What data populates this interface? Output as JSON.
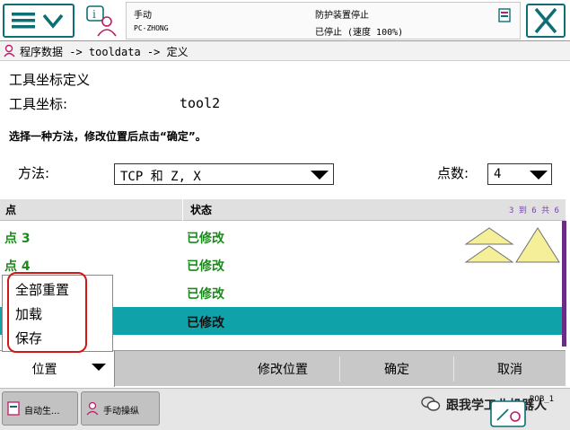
{
  "topbar": {
    "menu_icon": "hamburger-chevron-icon",
    "info_icon": "info-person-icon",
    "mode": "手动",
    "controller": "PC-ZHONG",
    "safety_status": "防护装置停止",
    "run_status": "已停止 (速度 100%)",
    "close_icon": "close-x-icon"
  },
  "breadcrumb": {
    "icon": "program-data-icon",
    "text": "程序数据 -> tooldata -> 定义"
  },
  "page": {
    "title": "工具坐标定义",
    "tool_label": "工具坐标:",
    "tool_value": "tool2",
    "instruction": "选择一种方法，修改位置后点击“确定”。"
  },
  "method": {
    "label": "方法:",
    "value": "TCP 和 Z, X"
  },
  "points": {
    "label": "点数:",
    "value": "4"
  },
  "table": {
    "headers": [
      "点",
      "状态"
    ],
    "paging": "3 到 6 共 6",
    "rows": [
      {
        "point": "点 3",
        "status": "已修改"
      },
      {
        "point": "点 4",
        "status": "已修改"
      },
      {
        "point": "",
        "status": "已修改"
      },
      {
        "point": "",
        "status": "已修改"
      }
    ]
  },
  "popup": {
    "items": [
      "全部重置",
      "加载",
      "保存"
    ]
  },
  "toolbar": {
    "position_label": "位置",
    "modify_label": "修改位置",
    "ok_label": "确定",
    "cancel_label": "取消"
  },
  "taskbar": {
    "task1": "自动生...",
    "task2": "手动操纵",
    "watermark": "跟我学工业机器人",
    "corner_text": "ROB_1"
  }
}
